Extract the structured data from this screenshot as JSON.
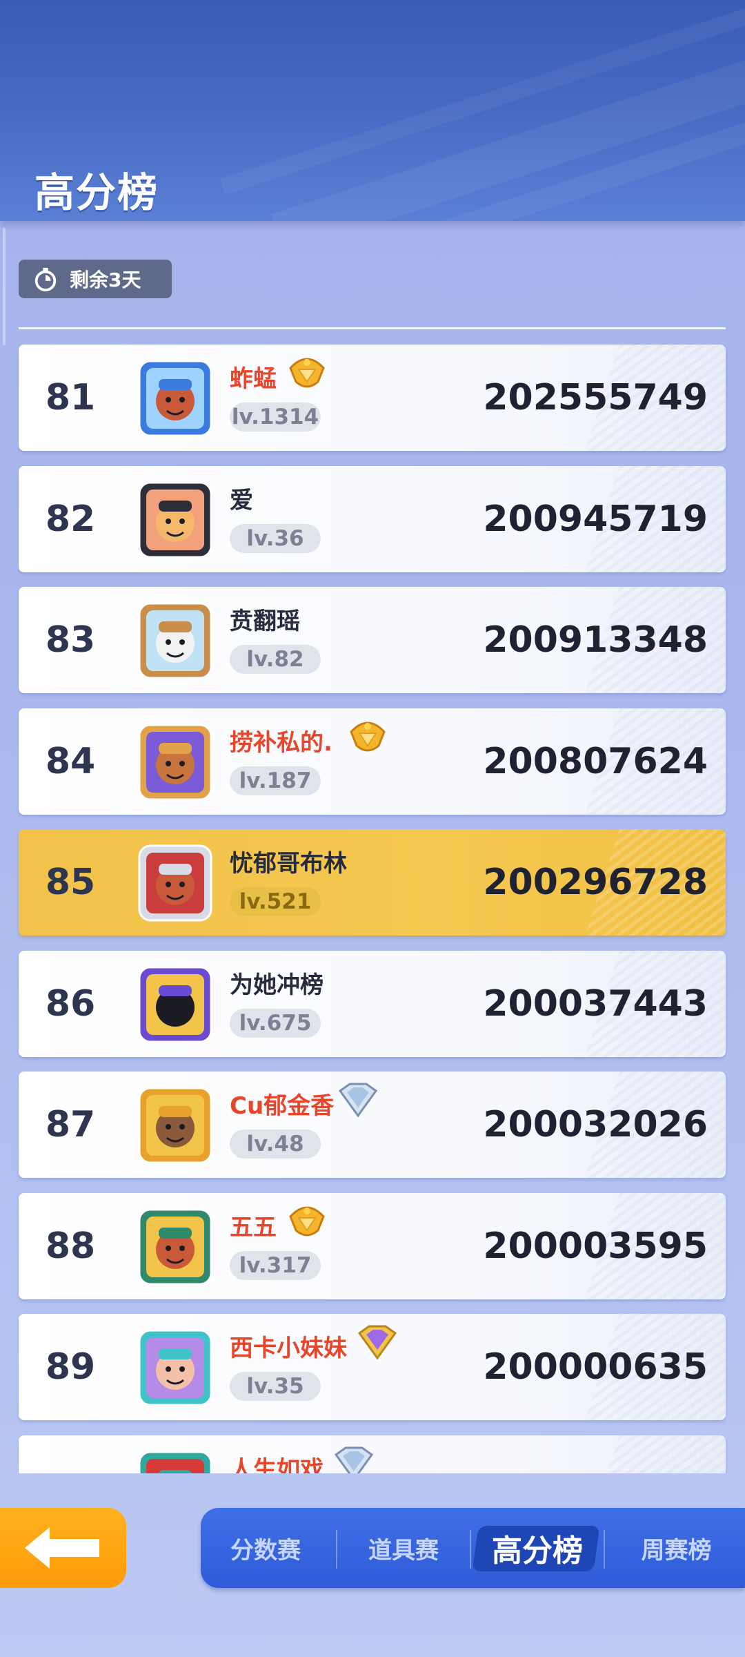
{
  "header": {
    "title": "高分榜"
  },
  "timer": {
    "label": "剩余3天",
    "icon": "stopwatch-icon"
  },
  "leaderboard": [
    {
      "rank": "81",
      "name": "蚱蜢",
      "level": "lv.1314",
      "score": "202555749",
      "name_color": "red",
      "badge": "gold-crown-badge",
      "avatar_colors": [
        "#3b7be0",
        "#9fd3ff",
        "#c85a3a"
      ],
      "highlight": false
    },
    {
      "rank": "82",
      "name": "爱",
      "level": "lv.36",
      "score": "200945719",
      "name_color": "dark",
      "badge": "",
      "avatar_colors": [
        "#2c2f3a",
        "#f3a07c",
        "#f5b86a"
      ],
      "highlight": false
    },
    {
      "rank": "83",
      "name": "贲翻瑶",
      "level": "lv.82",
      "score": "200913348",
      "name_color": "dark",
      "badge": "",
      "avatar_colors": [
        "#c98d4c",
        "#bfe3f5",
        "#f2f2f2"
      ],
      "highlight": false
    },
    {
      "rank": "84",
      "name": "捞补私的.",
      "level": "lv.187",
      "score": "200807624",
      "name_color": "red",
      "badge": "gold-crown-badge",
      "avatar_colors": [
        "#e2a24a",
        "#7c5bd6",
        "#c8743f"
      ],
      "highlight": false
    },
    {
      "rank": "85",
      "name": "忧郁哥布林",
      "level": "lv.521",
      "score": "200296728",
      "name_color": "dark",
      "badge": "",
      "avatar_colors": [
        "#d8dbe6",
        "#c93d3d",
        "#c85a3a"
      ],
      "highlight": true
    },
    {
      "rank": "86",
      "name": "为她冲榜",
      "level": "lv.675",
      "score": "200037443",
      "name_color": "dark",
      "badge": "",
      "avatar_colors": [
        "#6a4ad0",
        "#f2c44a",
        "#1c1c24"
      ],
      "highlight": false
    },
    {
      "rank": "87",
      "name": "Cu郁金香",
      "level": "lv.48",
      "score": "200032026",
      "name_color": "red",
      "badge": "diamond-badge",
      "avatar_colors": [
        "#e7a12c",
        "#f2c44a",
        "#8a5a3a"
      ],
      "highlight": false
    },
    {
      "rank": "88",
      "name": "五五",
      "level": "lv.317",
      "score": "200003595",
      "name_color": "red",
      "badge": "gold-crown-badge",
      "avatar_colors": [
        "#2f8a6c",
        "#f2c44a",
        "#c85a3a"
      ],
      "highlight": false
    },
    {
      "rank": "89",
      "name": "西卡小妹妹",
      "level": "lv.35",
      "score": "200000635",
      "name_color": "red",
      "badge": "purple-diamond-badge",
      "avatar_colors": [
        "#3fc3c8",
        "#b48ce8",
        "#f4c0a8"
      ],
      "highlight": false
    },
    {
      "rank": "",
      "name": "人生如戏",
      "level": "",
      "score": "",
      "name_color": "red",
      "badge": "diamond-badge",
      "avatar_colors": [
        "#2fa8a0",
        "#d83a3a",
        "#f2c44a"
      ],
      "highlight": false
    }
  ],
  "bottom_nav": {
    "back_icon": "back-arrow-icon",
    "tabs": [
      {
        "label": "分数赛",
        "active": false
      },
      {
        "label": "道具赛",
        "active": false
      },
      {
        "label": "高分榜",
        "active": true
      },
      {
        "label": "周赛榜",
        "active": false
      }
    ]
  },
  "colors": {
    "header_blue": "#3a5cb5",
    "tab_blue": "#2f5bd8",
    "highlight_gold": "#f2c24a",
    "back_orange": "#ffa010",
    "name_red": "#e8452a"
  }
}
